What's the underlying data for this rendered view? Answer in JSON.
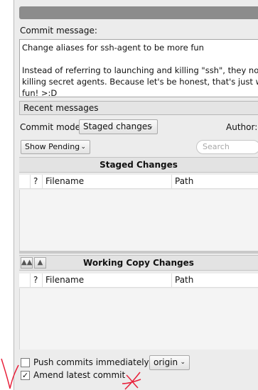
{
  "commit_message": {
    "label": "Commit message:",
    "lines": [
      "Change aliases for ssh-agent to be more fun",
      "",
      "Instead of referring to launching and killing \"ssh\", they now refe",
      "killing secret agents. Because let's be honest, that's just way mo",
      "fun! >:D"
    ]
  },
  "recent_messages_label": "Recent messages",
  "commit_mode": {
    "label": "Commit mode:",
    "value": "Staged changes"
  },
  "author_label": "Author:",
  "show_pending": {
    "value": "Show Pending"
  },
  "search": {
    "placeholder": "Search"
  },
  "staged": {
    "title": "Staged Changes",
    "columns": {
      "status": "?",
      "filename": "Filename",
      "path": "Path"
    }
  },
  "working_copy": {
    "title": "Working Copy Changes",
    "columns": {
      "status": "?",
      "filename": "Filename",
      "path": "Path"
    }
  },
  "push": {
    "label": "Push commits immediately to:",
    "remote": "origin",
    "checked": false
  },
  "amend": {
    "label": "Amend latest commit",
    "checked": true
  },
  "annotation_color": "#e8203a"
}
